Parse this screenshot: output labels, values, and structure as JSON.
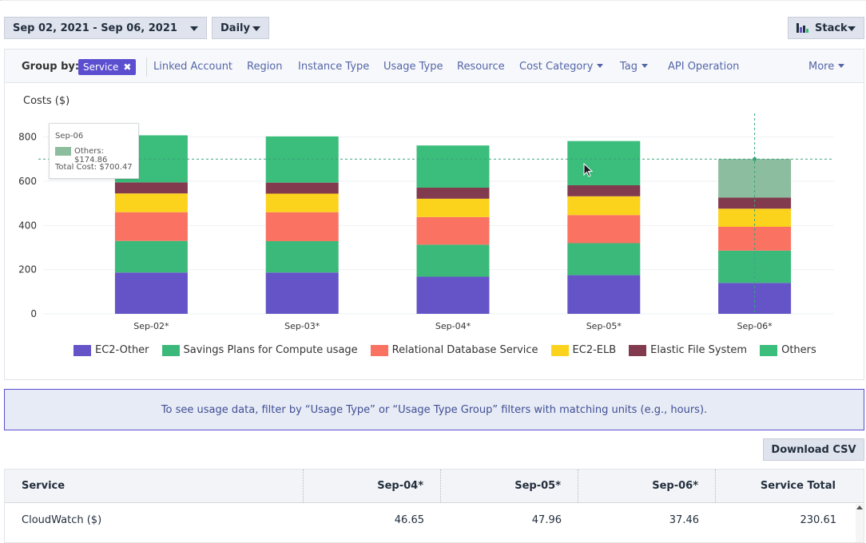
{
  "toolbar": {
    "date_range": "Sep 02, 2021 - Sep 06, 2021",
    "granularity": "Daily",
    "chart_style": "Stack"
  },
  "group_by": {
    "label": "Group by:",
    "selected": "Service",
    "options": [
      "Linked Account",
      "Region",
      "Instance Type",
      "Usage Type",
      "Resource",
      "Cost Category",
      "Tag",
      "API Operation",
      "More"
    ]
  },
  "chart_data": {
    "type": "bar",
    "stacked": true,
    "ylabel": "Costs ($)",
    "ylim": [
      0,
      900
    ],
    "yticks": [
      0,
      200,
      400,
      600,
      800
    ],
    "categories": [
      "Sep-02*",
      "Sep-03*",
      "Sep-04*",
      "Sep-05*",
      "Sep-06*"
    ],
    "series": [
      {
        "name": "EC2-Other",
        "color": "#6554c8",
        "values": [
          187,
          187,
          168,
          175,
          140
        ]
      },
      {
        "name": "Savings Plans for Compute usage",
        "color": "#3bb97a",
        "values": [
          143,
          142,
          145,
          145,
          146
        ]
      },
      {
        "name": "Relational Database Service",
        "color": "#fa7262",
        "values": [
          130,
          131,
          125,
          127,
          108
        ]
      },
      {
        "name": "EC2-ELB",
        "color": "#fcd31c",
        "values": [
          85,
          84,
          83,
          85,
          82
        ]
      },
      {
        "name": "Elastic File System",
        "color": "#823b4e",
        "values": [
          50,
          50,
          50,
          50,
          50
        ]
      },
      {
        "name": "Others",
        "color": "#3bbd7c",
        "values": [
          213,
          209,
          191,
          200,
          174.86
        ]
      }
    ],
    "grid": true,
    "legend": "bottom",
    "reference_line": 700.47
  },
  "tooltip": {
    "date": "Sep-06",
    "series_value": "Others: $174.86",
    "total": "Total Cost: $700.47"
  },
  "banner": {
    "text": "To see usage data, filter by “Usage Type” or “Usage Type Group” filters with matching units (e.g., hours)."
  },
  "download": {
    "label": "Download CSV"
  },
  "table": {
    "headers": [
      "Service",
      "Sep-04*",
      "Sep-05*",
      "Sep-06*",
      "Service Total"
    ],
    "rows": [
      [
        "CloudWatch ($)",
        "46.65",
        "47.96",
        "37.46",
        "230.61"
      ]
    ]
  }
}
